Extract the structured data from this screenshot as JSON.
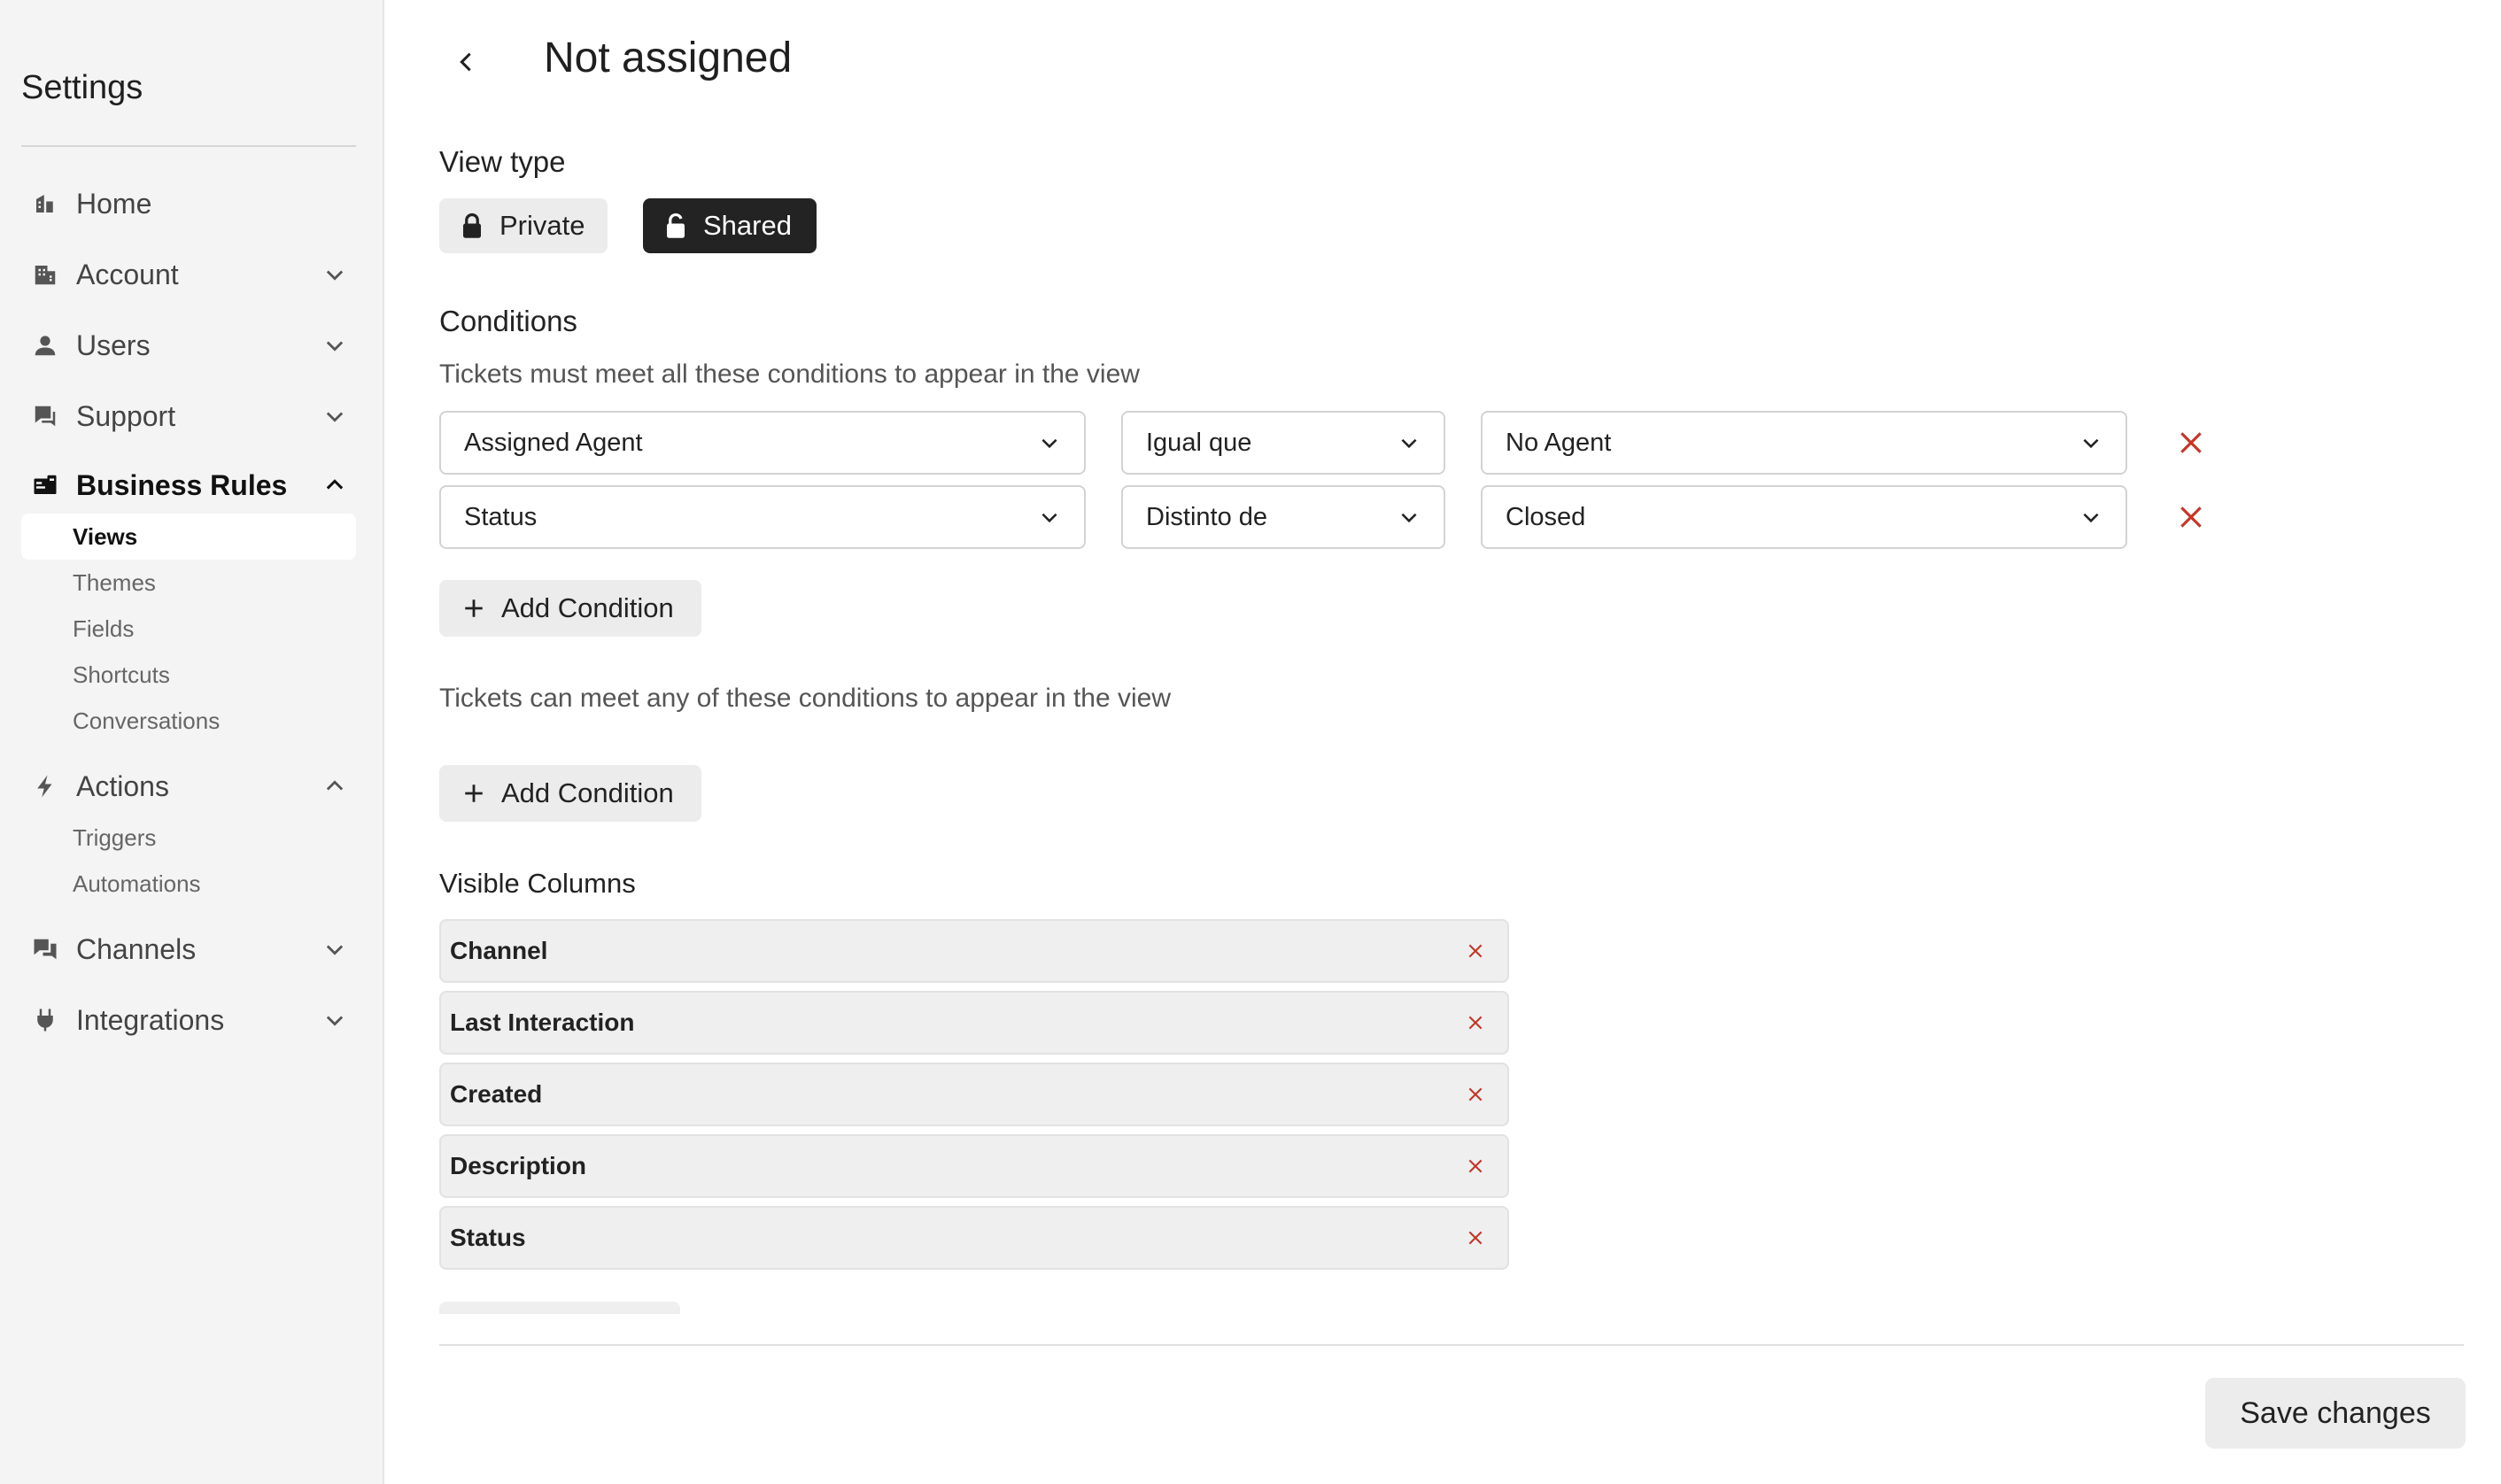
{
  "sidebar": {
    "title": "Settings",
    "items": [
      {
        "label": "Home",
        "icon": "home-icon"
      },
      {
        "label": "Account",
        "icon": "building-icon"
      },
      {
        "label": "Users",
        "icon": "user-icon"
      },
      {
        "label": "Support",
        "icon": "chat-icon"
      },
      {
        "label": "Business Rules",
        "icon": "rules-icon"
      },
      {
        "label": "Actions",
        "icon": "lightning-icon"
      },
      {
        "label": "Channels",
        "icon": "chat-bubbles-icon"
      },
      {
        "label": "Integrations",
        "icon": "plug-icon"
      }
    ],
    "business_rules_sub": [
      "Views",
      "Themes",
      "Fields",
      "Shortcuts",
      "Conversations"
    ],
    "actions_sub": [
      "Triggers",
      "Automations"
    ],
    "active_sub": "Views"
  },
  "header": {
    "title": "Not assigned"
  },
  "view_type": {
    "label": "View type",
    "private_label": "Private",
    "shared_label": "Shared",
    "selected": "Shared"
  },
  "conditions": {
    "label": "Conditions",
    "all_helper": "Tickets must meet all these conditions to appear in the view",
    "all_rows": [
      {
        "field": "Assigned Agent",
        "operator": "Igual que",
        "value": "No Agent"
      },
      {
        "field": "Status",
        "operator": "Distinto de",
        "value": "Closed"
      }
    ],
    "add_label": "Add Condition",
    "any_helper": "Tickets can meet any of these conditions to appear in the view",
    "any_rows": []
  },
  "visible_columns": {
    "label": "Visible Columns",
    "items": [
      "Channel",
      "Last Interaction",
      "Created",
      "Description",
      "Status"
    ]
  },
  "footer": {
    "save_label": "Save changes"
  },
  "colors": {
    "remove_red": "#c0392b",
    "shared_bg": "#232323"
  }
}
